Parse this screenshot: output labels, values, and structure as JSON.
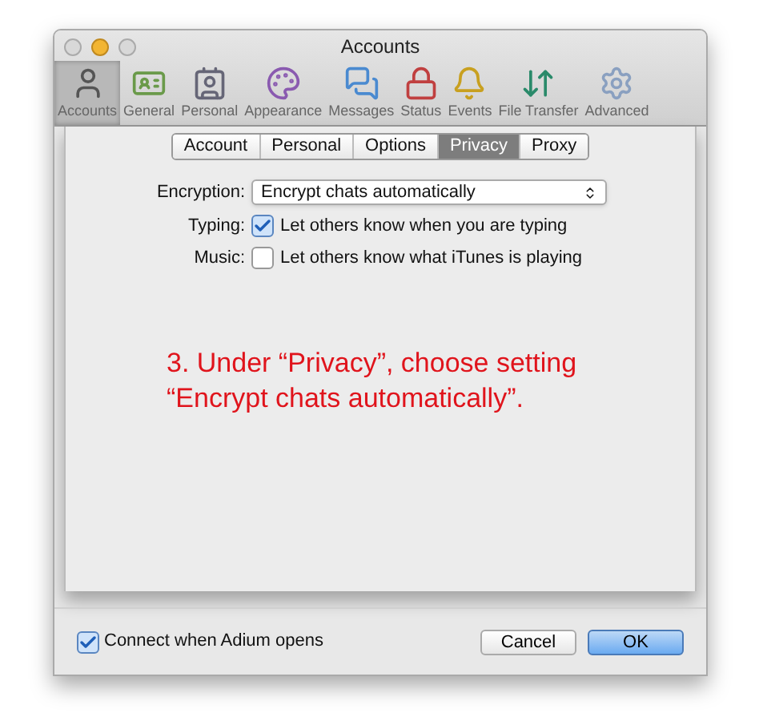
{
  "window": {
    "title": "Accounts"
  },
  "toolbar": [
    {
      "label": "Accounts",
      "selected": true
    },
    {
      "label": "General",
      "selected": false
    },
    {
      "label": "Personal",
      "selected": false
    },
    {
      "label": "Appearance",
      "selected": false
    },
    {
      "label": "Messages",
      "selected": false
    },
    {
      "label": "Status",
      "selected": false
    },
    {
      "label": "Events",
      "selected": false
    },
    {
      "label": "File Transfer",
      "selected": false
    },
    {
      "label": "Advanced",
      "selected": false
    }
  ],
  "tabs": [
    {
      "label": "Account",
      "selected": false
    },
    {
      "label": "Personal",
      "selected": false
    },
    {
      "label": "Options",
      "selected": false
    },
    {
      "label": "Privacy",
      "selected": true
    },
    {
      "label": "Proxy",
      "selected": false
    }
  ],
  "encryption": {
    "label": "Encryption:",
    "value": "Encrypt chats automatically"
  },
  "options": [
    {
      "label": "Typing:",
      "text": "Let others know when you are typing",
      "checked": true
    },
    {
      "label": "Music:",
      "text": "Let others know what iTunes is playing",
      "checked": false
    }
  ],
  "annotation": [
    "3. Under “Privacy”, choose setting",
    "“Encrypt chats automatically”."
  ],
  "connect": {
    "text": "Connect when Adium opens",
    "checked": true
  },
  "buttons": [
    {
      "label": "Cancel",
      "kind": "normal"
    },
    {
      "label": "OK",
      "kind": "default"
    }
  ]
}
